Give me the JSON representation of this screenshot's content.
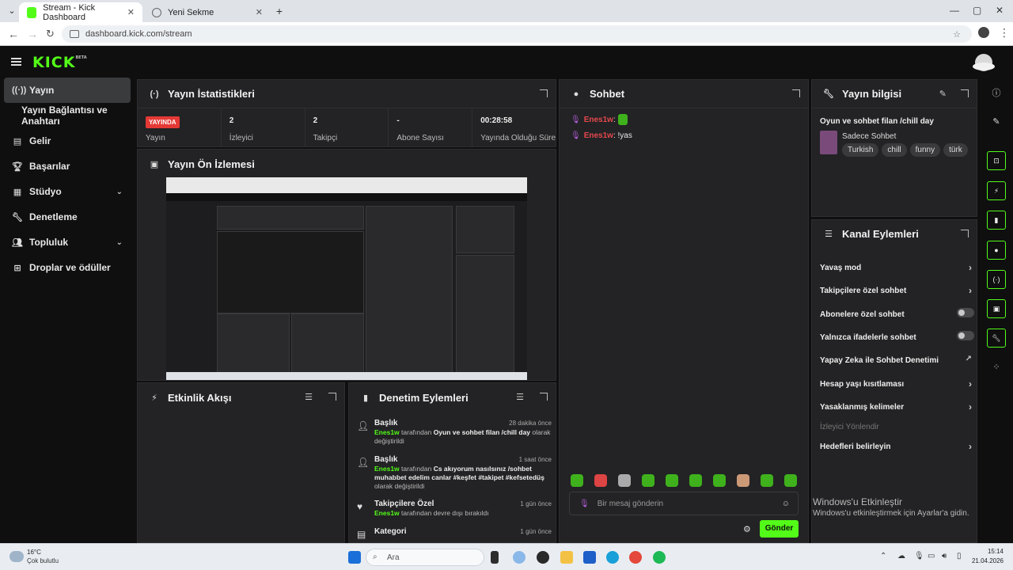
{
  "browser": {
    "tabs": [
      {
        "title": "Stream - Kick Dashboard"
      },
      {
        "title": "Yeni Sekme"
      }
    ],
    "url": "dashboard.kick.com/stream"
  },
  "header": {
    "logo": "KICK",
    "logo_badge": "BETA"
  },
  "sidebar": {
    "items": [
      {
        "label": "Yayın",
        "icon": "broadcast-icon"
      },
      {
        "label": "Yayın Bağlantısı ve Anahtarı",
        "icon": ""
      },
      {
        "label": "Gelir",
        "icon": "money-icon"
      },
      {
        "label": "Başarılar",
        "icon": "trophy-icon"
      },
      {
        "label": "Stüdyo",
        "icon": "studio-icon"
      },
      {
        "label": "Denetleme",
        "icon": "wrench-icon"
      },
      {
        "label": "Topluluk",
        "icon": "community-icon"
      },
      {
        "label": "Droplar ve ödüller",
        "icon": "gift-icon"
      }
    ]
  },
  "stats": {
    "title": "Yayın İstatistikleri",
    "live_badge": "YAYINDA",
    "items": [
      {
        "value": "",
        "label": "Yayın"
      },
      {
        "value": "2",
        "label": "İzleyici"
      },
      {
        "value": "2",
        "label": "Takipçi"
      },
      {
        "value": "-",
        "label": "Abone Sayısı"
      },
      {
        "value": "00:28:58",
        "label": "Yayında Olduğu Süre"
      }
    ]
  },
  "preview": {
    "title": "Yayın Ön İzlemesi"
  },
  "activity": {
    "title": "Etkinlik Akışı"
  },
  "moderation": {
    "title": "Denetim Eylemleri",
    "items": [
      {
        "title": "Başlık",
        "time": "28 dakika önce",
        "user": "Enes1w",
        "pre": "tarafından",
        "bold": "Oyun ve sohbet filan /chill day",
        "post": "olarak değiştirildi"
      },
      {
        "title": "Başlık",
        "time": "1 saat önce",
        "user": "Enes1w",
        "pre": "tarafından",
        "bold": "Cs akıyorum nasılsınız /sohbet muhabbet edelim canlar #keşfet #takipet #kefsetedüş",
        "post": "olarak değiştirildi"
      },
      {
        "title": "Takipçilere Özel",
        "time": "1 gün önce",
        "user": "Enes1w",
        "pre": "tarafından devre dışı bırakıldı",
        "bold": "",
        "post": ""
      },
      {
        "title": "Kategori",
        "time": "1 gün önce",
        "user": "",
        "pre": "",
        "bold": "",
        "post": ""
      }
    ]
  },
  "chat": {
    "title": "Sohbet",
    "messages": [
      {
        "user": "Enes1w",
        "text": ""
      },
      {
        "user": "Enes1w",
        "text": "!yas"
      }
    ],
    "placeholder": "Bir mesaj gönderin",
    "send": "Gönder"
  },
  "stream_info": {
    "title": "Yayın bilgisi",
    "stream_title": "Oyun ve sohbet filan /chill day",
    "category": "Sadece Sohbet",
    "tags": [
      "Turkish",
      "chill",
      "funny",
      "türk"
    ]
  },
  "channel_actions": {
    "title": "Kanal Eylemleri",
    "items": [
      {
        "label": "Yavaş mod",
        "type": "arrow"
      },
      {
        "label": "Takipçilere özel sohbet",
        "type": "arrow"
      },
      {
        "label": "Abonelere özel sohbet",
        "type": "toggle"
      },
      {
        "label": "Yalnızca ifadelerle sohbet",
        "type": "toggle"
      },
      {
        "label": "Yapay Zeka ile Sohbet Denetimi",
        "type": "external"
      },
      {
        "label": "Hesap yaşı kısıtlaması",
        "type": "arrow"
      },
      {
        "label": "Yasaklanmış kelimeler",
        "type": "arrow"
      },
      {
        "label": "İzleyici Yönlendir",
        "type": "disabled"
      },
      {
        "label": "Hedefleri belirleyin",
        "type": "arrow"
      }
    ]
  },
  "watermark": {
    "title": "Windows'u Etkinleştir",
    "sub": "Windows'u etkinleştirmek için Ayarlar'a gidin."
  },
  "taskbar": {
    "weather_temp": "16°C",
    "weather_desc": "Çok bulutlu",
    "search": "Ara",
    "time": "15:14",
    "date": "21.04.2026"
  }
}
